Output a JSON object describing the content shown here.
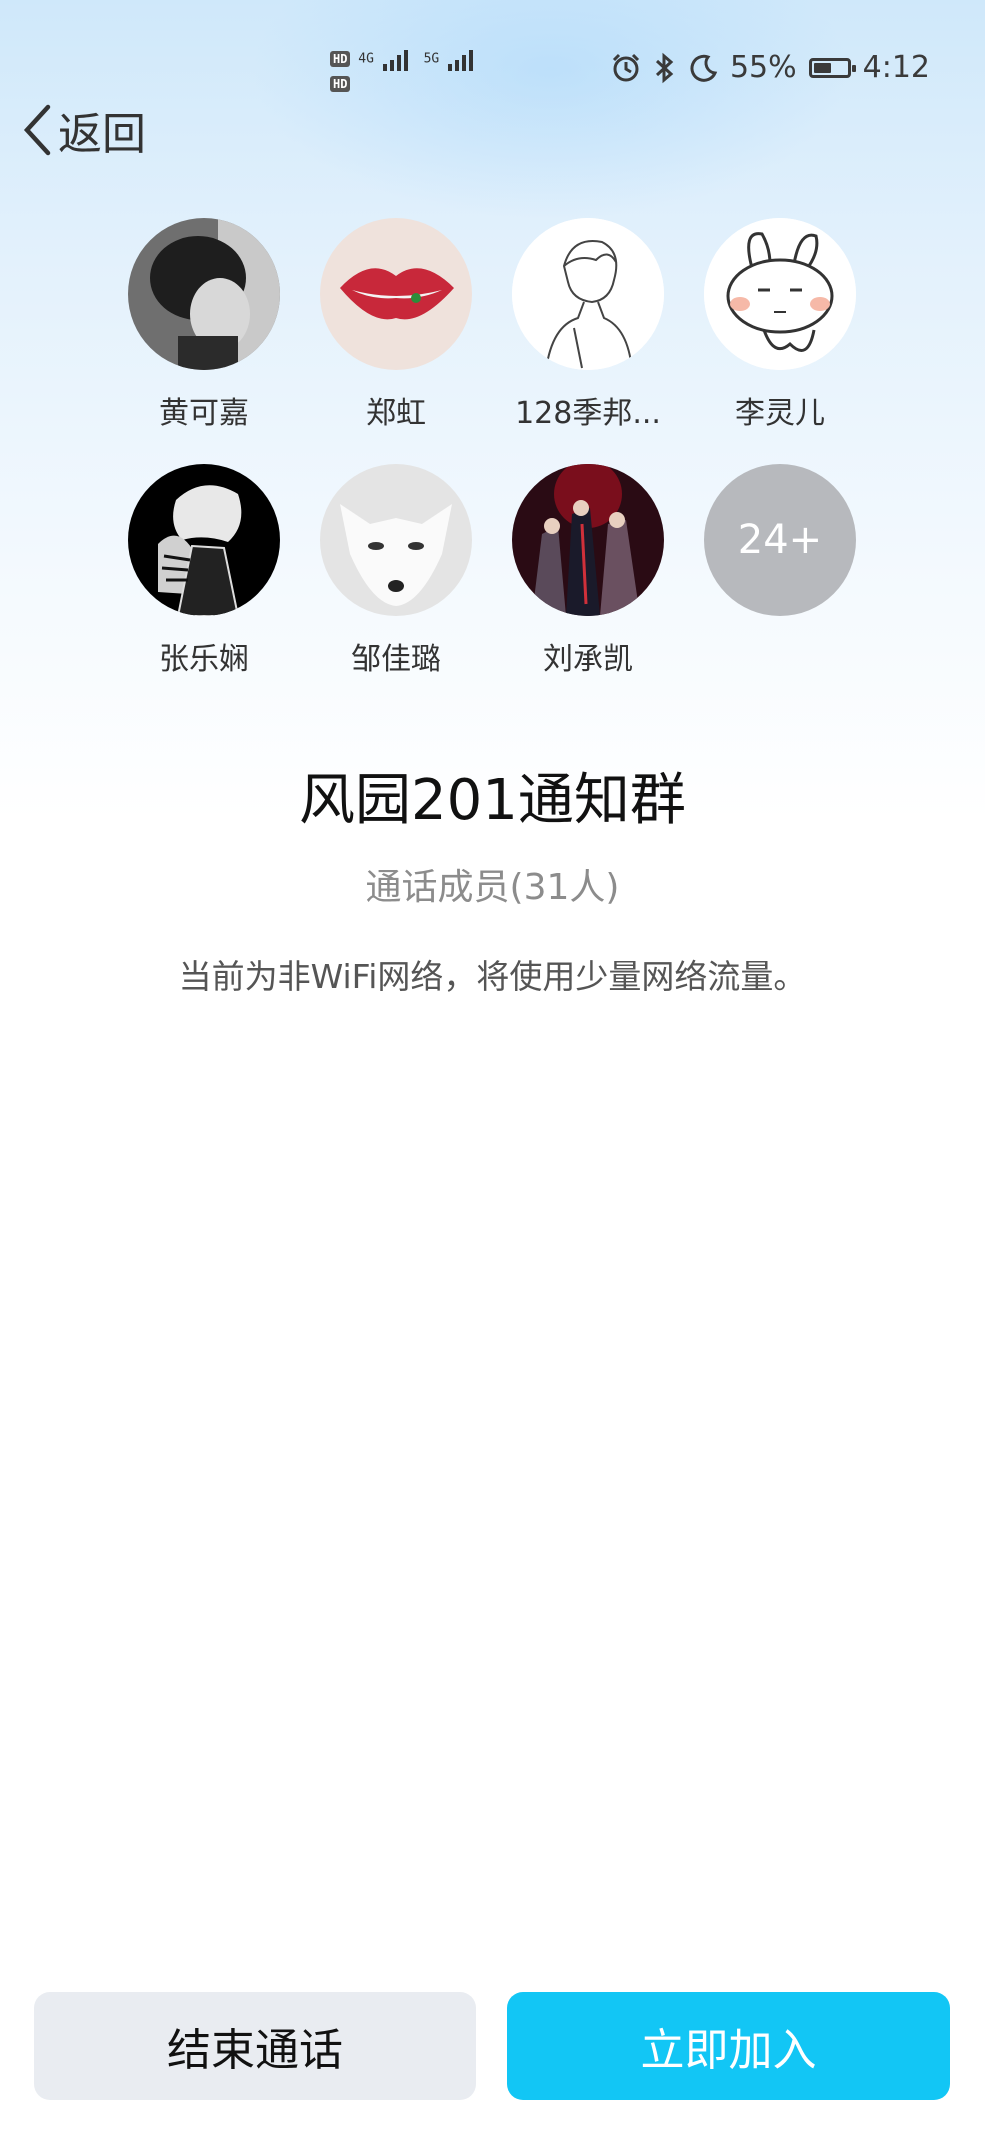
{
  "status_bar": {
    "hd1": "HD",
    "hd2": "HD",
    "net1": "4G",
    "net2": "5G",
    "battery_percent": "55%",
    "battery_level": 0.55,
    "time": "4:12"
  },
  "nav": {
    "back_label": "返回"
  },
  "members": [
    {
      "name": "黄可嘉",
      "avatar": "dark-portrait"
    },
    {
      "name": "郑虹",
      "avatar": "lips"
    },
    {
      "name": "128季邦...",
      "avatar": "line-drawing-boy"
    },
    {
      "name": "李灵儿",
      "avatar": "cartoon-rabbit"
    },
    {
      "name": "张乐娴",
      "avatar": "manga-character"
    },
    {
      "name": "邹佳璐",
      "avatar": "white-fox"
    },
    {
      "name": "刘承凯",
      "avatar": "anime-group"
    }
  ],
  "more_count": "24+",
  "group": {
    "title": "风园201通知群",
    "members_text": "通话成员(31人)",
    "notice": "当前为非WiFi网络，将使用少量网络流量。"
  },
  "actions": {
    "end_label": "结束通话",
    "join_label": "立即加入"
  },
  "colors": {
    "join": "#12c6f5",
    "end": "#e9ecf1"
  }
}
